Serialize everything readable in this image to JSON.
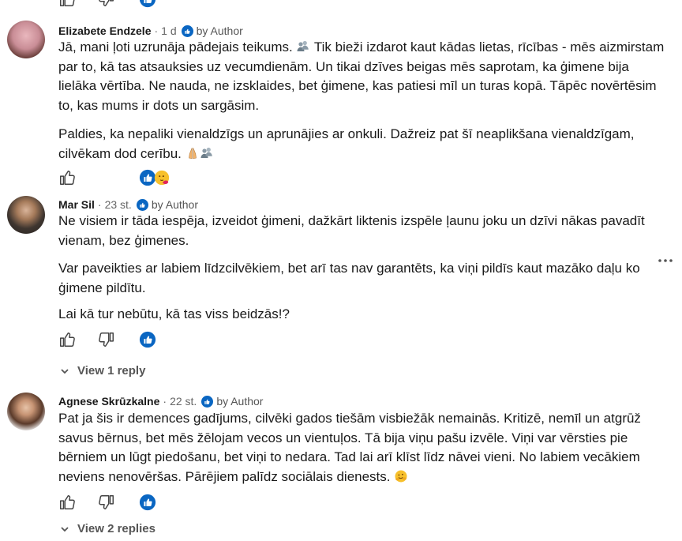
{
  "comments": [
    {
      "author": "Elizabete Endzele",
      "time": "1 d",
      "badge": "by Author",
      "paragraphs": [
        "Jā, mani ļoti uzrunāja pādejais teikums.",
        "Tik bieži izdarot kaut kādas lietas, rīcības - mēs aizmirstam par to, kā tas atsauksies uz vecumdienām. Un tikai dzīves beigas mēs saprotam, ka ģimene bija lielāka vērtība. Ne nauda, ne izsklaides, bet ģimene, kas patiesi mīl un turas kopā. Tāpēc novērtēsim to, kas mums ir dots un sargāsim.",
        "Paldies, ka nepaliki vienaldzīgs un aprunājies ar onkuli. Dažreiz pat šī neaplikšana vienaldzīgam, cilvēkam dod cerību."
      ]
    },
    {
      "author": "Mar Sil",
      "time": "23 st.",
      "badge": "by Author",
      "paragraphs": [
        "Ne visiem ir tāda iespēja, izveidot ģimeni, dažkārt liktenis izspēle ļaunu joku un dzīvi nākas pavadīt vienam, bez ģimenes.",
        "Var paveikties ar labiem līdzcilvēkiem, bet arī tas nav garantēts, ka viņi pildīs kaut mazāko daļu ko ģimene pildītu.",
        "Lai kā tur nebūtu, kā tas viss beidzās!?"
      ],
      "reply_link": "View 1 reply"
    },
    {
      "author": "Agnese Skrūzkalne",
      "time": "22 st.",
      "badge": "by Author",
      "paragraphs": [
        "Pat ja šis ir demences gadījums, cilvēki gados tiešām visbiežāk nemainās. Kritizē, nemīl un atgrūž savus bērnus, bet mēs žēlojam vecos un vientuļos. Tā bija viņu pašu izvēle. Viņi var vērsties pie bērniem un lūgt piedošanu, bet viņi to nedara. Tad lai arī klīst līdz nāvei vieni. No labiem vecākiem neviens nenovēršas. Pārējiem palīdz sociālais dienests."
      ],
      "reply_link": "View 2 replies"
    }
  ],
  "icons": {
    "like": "thumbs-up-icon",
    "dislike": "thumbs-down-icon",
    "reaction": "like-reaction-icon",
    "hug": "hug-emoji-icon",
    "pray": "folded-hands-emoji-icon",
    "more": "more-options-icon",
    "chevron": "chevron-down-icon"
  },
  "colors": {
    "accent": "#0a66c2",
    "text": "#191919",
    "muted": "#666666"
  }
}
